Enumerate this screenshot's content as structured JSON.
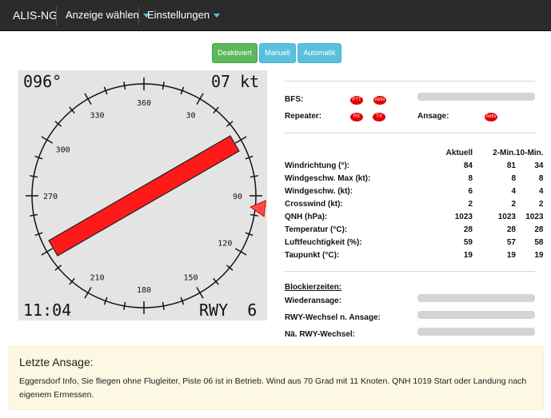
{
  "nav": {
    "brand": "ALIS-NG",
    "menu1": "Anzeige wählen",
    "menu2": "Einstellungen"
  },
  "mode_buttons": {
    "deactivated": "Deaktiviert",
    "manual": "Manuell",
    "automatic": "Automatik",
    "active_color": "#5cb85c",
    "inactive_color": "#5bc0de"
  },
  "compass": {
    "direction": "096°",
    "speed": "07 kt",
    "time": "11:04",
    "runway": "RWY  6",
    "runway_heading_deg": 60,
    "wind_from_deg": 96,
    "labels": [
      {
        "text": "360",
        "deg": 0
      },
      {
        "text": "30",
        "deg": 30
      },
      {
        "text": "90",
        "deg": 90
      },
      {
        "text": "120",
        "deg": 120
      },
      {
        "text": "150",
        "deg": 150
      },
      {
        "text": "180",
        "deg": 180
      },
      {
        "text": "210",
        "deg": 210
      },
      {
        "text": "270",
        "deg": 270
      },
      {
        "text": "300",
        "deg": 300
      },
      {
        "text": "330",
        "deg": 330
      }
    ]
  },
  "status": {
    "bfs_label": "BFS:",
    "repeater_label": "Repeater:",
    "ansage_label": "Ansage:",
    "ptt": "PTT",
    "aktiv": "Aktiv",
    "rx": "RX",
    "tx": "TX",
    "ansage_aktiv": "Aktiv",
    "indicator_color": "#e00000"
  },
  "weather": {
    "headers": [
      "",
      "Aktuell",
      "2-Min.",
      "10-Min."
    ],
    "rows": [
      {
        "label": "Windrichtung (°):",
        "values": [
          "84",
          "81",
          "34"
        ]
      },
      {
        "label": "Windgeschw. Max (kt):",
        "values": [
          "8",
          "8",
          "8"
        ]
      },
      {
        "label": "Windgeschw. (kt):",
        "values": [
          "6",
          "4",
          "4"
        ]
      },
      {
        "label": "Crosswind (kt):",
        "values": [
          "2",
          "2",
          "2"
        ]
      },
      {
        "label": "QNH (hPa):",
        "values": [
          "1023",
          "1023",
          "1023"
        ]
      },
      {
        "label": "Temperatur (°C):",
        "values": [
          "28",
          "28",
          "28"
        ]
      },
      {
        "label": "Luftfeuchtigkeit (%):",
        "values": [
          "59",
          "57",
          "58"
        ]
      },
      {
        "label": "Taupunkt (°C):",
        "values": [
          "19",
          "19",
          "19"
        ]
      }
    ]
  },
  "block": {
    "title": "Blockierzeiten:",
    "wiederansage": "Wiederansage:",
    "rwy_wechsel_ansage": "RWY-Wechsel n. Ansage:",
    "na_rwy_wechsel": "Nä. RWY-Wechsel:"
  },
  "last_announcement": {
    "title": "Letzte Ansage:",
    "text": "Eggersdorf Info, Sie fliegen ohne Flugleiter, Piste 06 ist in Betrieb. Wind aus 70 Grad mit 11 Knoten. QNH 1019 Start oder Landung nach eigenem Ermessen."
  }
}
